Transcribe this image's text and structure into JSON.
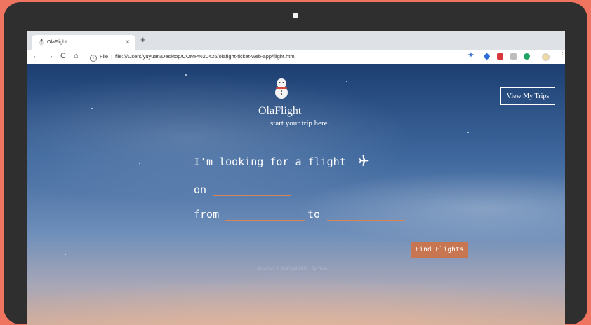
{
  "browser": {
    "tab_title": "OlaFlight",
    "tab_close": "×",
    "new_tab": "+",
    "nav": {
      "back": "←",
      "forward": "→",
      "reload": "C",
      "home": "⌂"
    },
    "address_scheme": "File",
    "address_url": "file:///Users/yuyuan/Desktop/COMP%20426/olafight-ticket-web-app/flight.html",
    "accent": "#4a78d8"
  },
  "header": {
    "brand": "OlaFlight",
    "tagline": "start your trip here.",
    "my_trips_label": "View My Trips"
  },
  "search": {
    "prompt": "I'm looking for a flight",
    "on_label": "on",
    "from_label": "from",
    "to_label": "to",
    "date_value": "",
    "from_value": "",
    "to_value": "",
    "submit_label": "Find Flights",
    "accent": "#c87551"
  },
  "footer": {
    "text": "Copyright © OlaFlight 2019 · By Yuan"
  }
}
